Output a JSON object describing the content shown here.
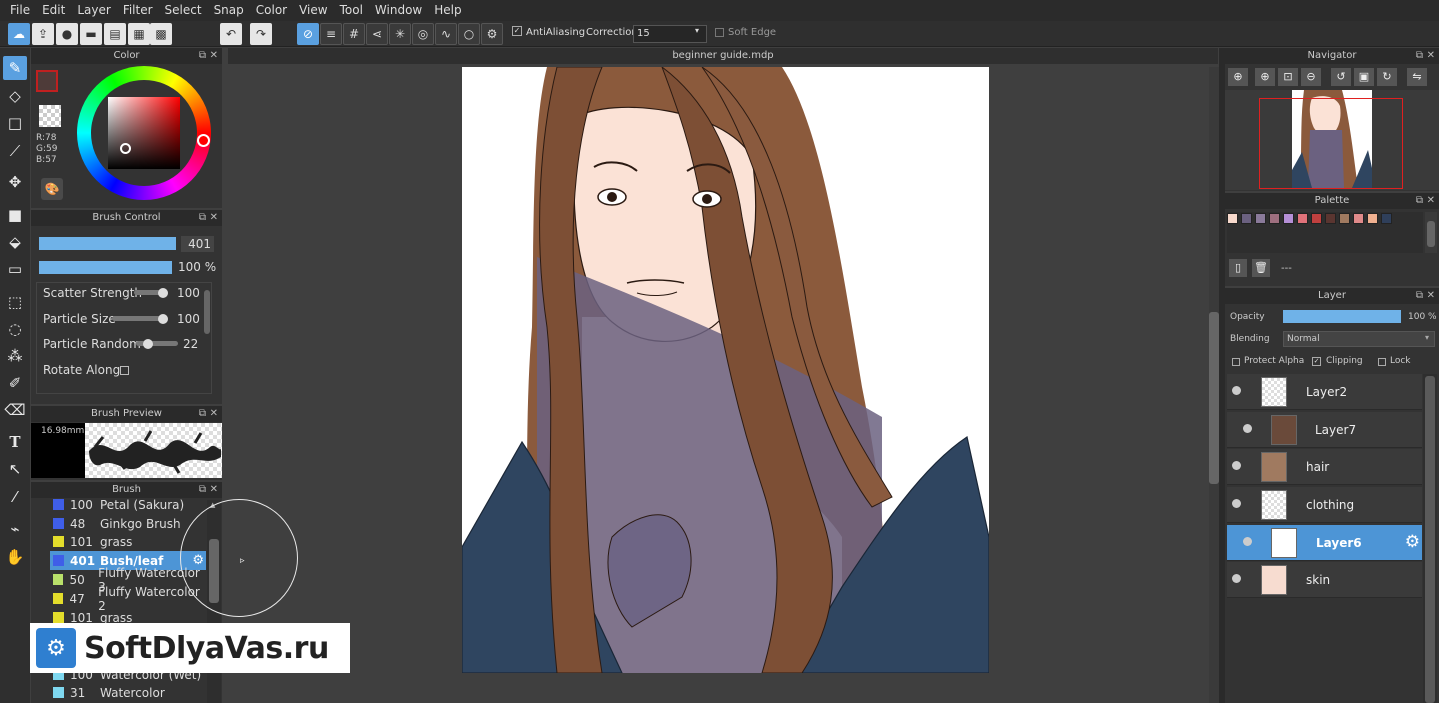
{
  "menu": [
    "File",
    "Edit",
    "Layer",
    "Filter",
    "Select",
    "Snap",
    "Color",
    "View",
    "Tool",
    "Window",
    "Help"
  ],
  "toolbar": {
    "antialiasing_label": "AntiAliasing",
    "correction_label": "Correction",
    "correction_value": "15",
    "soft_edge_label": "Soft Edge"
  },
  "color_panel": {
    "title": "Color",
    "r": "R:78",
    "g": "G:59",
    "b": "B:57",
    "current_color": "#4e3b39"
  },
  "brush_control": {
    "title": "Brush Control",
    "size_value": "401",
    "opacity_value": "100 %",
    "rows": [
      {
        "label": "Scatter Strength",
        "value": "100",
        "level": 100
      },
      {
        "label": "Particle Size",
        "value": "100",
        "level": 100
      },
      {
        "label": "Particle Random",
        "value": "22",
        "level": 22
      }
    ],
    "rotate_along_label": "Rotate Along"
  },
  "brush_preview": {
    "title": "Brush Preview",
    "size_text": "16.98mm"
  },
  "brush_panel": {
    "title": "Brush",
    "items": [
      {
        "num": "100",
        "name": "Petal (Sakura)",
        "color": "#3f5ee8"
      },
      {
        "num": "48",
        "name": "Ginkgo Brush",
        "color": "#3f5ee8"
      },
      {
        "num": "101",
        "name": "grass",
        "color": "#e3dd2b"
      },
      {
        "num": "401",
        "name": "Bush/leaf",
        "color": "#3f5ee8"
      },
      {
        "num": "50",
        "name": "Fluffy Watercolor 3",
        "color": "#b9e06a"
      },
      {
        "num": "47",
        "name": "Fluffy Watercolor 2",
        "color": "#e3dd2b"
      },
      {
        "num": "101",
        "name": "grass",
        "color": "#e3dd2b"
      },
      {
        "num": "100",
        "name": "Watercolor (Wet)",
        "color": "#7fd8f0"
      },
      {
        "num": "31",
        "name": "Watercolor",
        "color": "#7fd8f0"
      }
    ]
  },
  "document": {
    "tab_title": "beginner guide.mdp"
  },
  "watermark": {
    "text": "SoftDlyaVas.ru"
  },
  "navigator": {
    "title": "Navigator"
  },
  "palette": {
    "title": "Palette",
    "swatches": [
      "#f7d9cc",
      "#6b6180",
      "#8a7a9a",
      "#9e6f7f",
      "#b58fd6",
      "#e0727a",
      "#c0403f",
      "#5a3530",
      "#a07a60",
      "#e08a8a",
      "#f0b090",
      "#2f3f5a"
    ],
    "name": "---"
  },
  "layer_panel": {
    "title": "Layer",
    "opacity_label": "Opacity",
    "opacity_value": "100 %",
    "blending_label": "Blending",
    "blending_value": "Normal",
    "protect_alpha_label": "Protect Alpha",
    "clipping_label": "Clipping",
    "lock_label": "Lock",
    "layers": [
      {
        "name": "Layer2"
      },
      {
        "name": "Layer7"
      },
      {
        "name": "hair"
      },
      {
        "name": "clothing"
      },
      {
        "name": "Layer6"
      },
      {
        "name": "skin"
      }
    ]
  }
}
